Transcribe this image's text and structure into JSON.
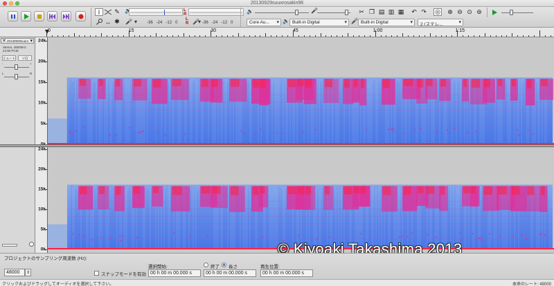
{
  "window": {
    "title": "20130929suuxrosakin96"
  },
  "toolbar": {
    "meters": {
      "play_label": "L\nR",
      "rec_label": "L\nR",
      "scale_play": [
        "-36",
        "-24",
        "-12",
        "0"
      ],
      "scale_rec": [
        "-36",
        "-24",
        "-12",
        "0"
      ]
    },
    "devices": {
      "host": "Core Au...",
      "output": "Built-in Digital",
      "input": "Built-in Digital",
      "channels": "2 (ステレ..."
    }
  },
  "ruler": {
    "labels": [
      {
        "text": "0",
        "t": 0
      },
      {
        "text": "15",
        "t": 15
      },
      {
        "text": "30",
        "t": 30
      },
      {
        "text": "45",
        "t": 45
      },
      {
        "text": "1:00",
        "t": 60
      },
      {
        "text": "1:15",
        "t": 75
      }
    ]
  },
  "track": {
    "name": "20130929suuro",
    "format_line1": "Stereo, 48000Hz",
    "format_line2": "24-bit PCM",
    "mute_label": "ミュート",
    "solo_label": "ソロ",
    "gain_minus": "-",
    "gain_plus": "+",
    "pan_left": "L",
    "pan_right": "R"
  },
  "channels": [
    {
      "y_labels": [
        "24k",
        "20k",
        "15k",
        "10k",
        "5k",
        "0k"
      ]
    },
    {
      "y_labels": [
        "24k",
        "20k",
        "15k",
        "10k",
        "5k",
        "0k"
      ]
    }
  ],
  "watermark": "© Kiyoaki Takashima 2013",
  "selection_bar": {
    "rate_label": "プロジェクトのサンプリング周波数 (Hz):",
    "rate_value": "48000",
    "snap_label": "スナップモードを有効",
    "sel_start_label": "選択開始:",
    "end_label": "終了",
    "length_label": "長さ",
    "position_label": "再生位置:",
    "sel_start_value": "00 h 00 m 00.000 s",
    "sel_end_value": "00 h 00 m 00.000 s",
    "position_value": "00 h 00 m 00.000 s"
  },
  "status": {
    "left": "クリックおよびドラッグしてオーディオを選択して下さい。",
    "right": "本来のレート: 48000"
  },
  "colors": {
    "spectrogram_bg": "#c9c9c9",
    "spectrogram_blue": "#5a8cf0",
    "spectrogram_magenta": "#e0309a",
    "spectrogram_red": "#ff2040"
  }
}
